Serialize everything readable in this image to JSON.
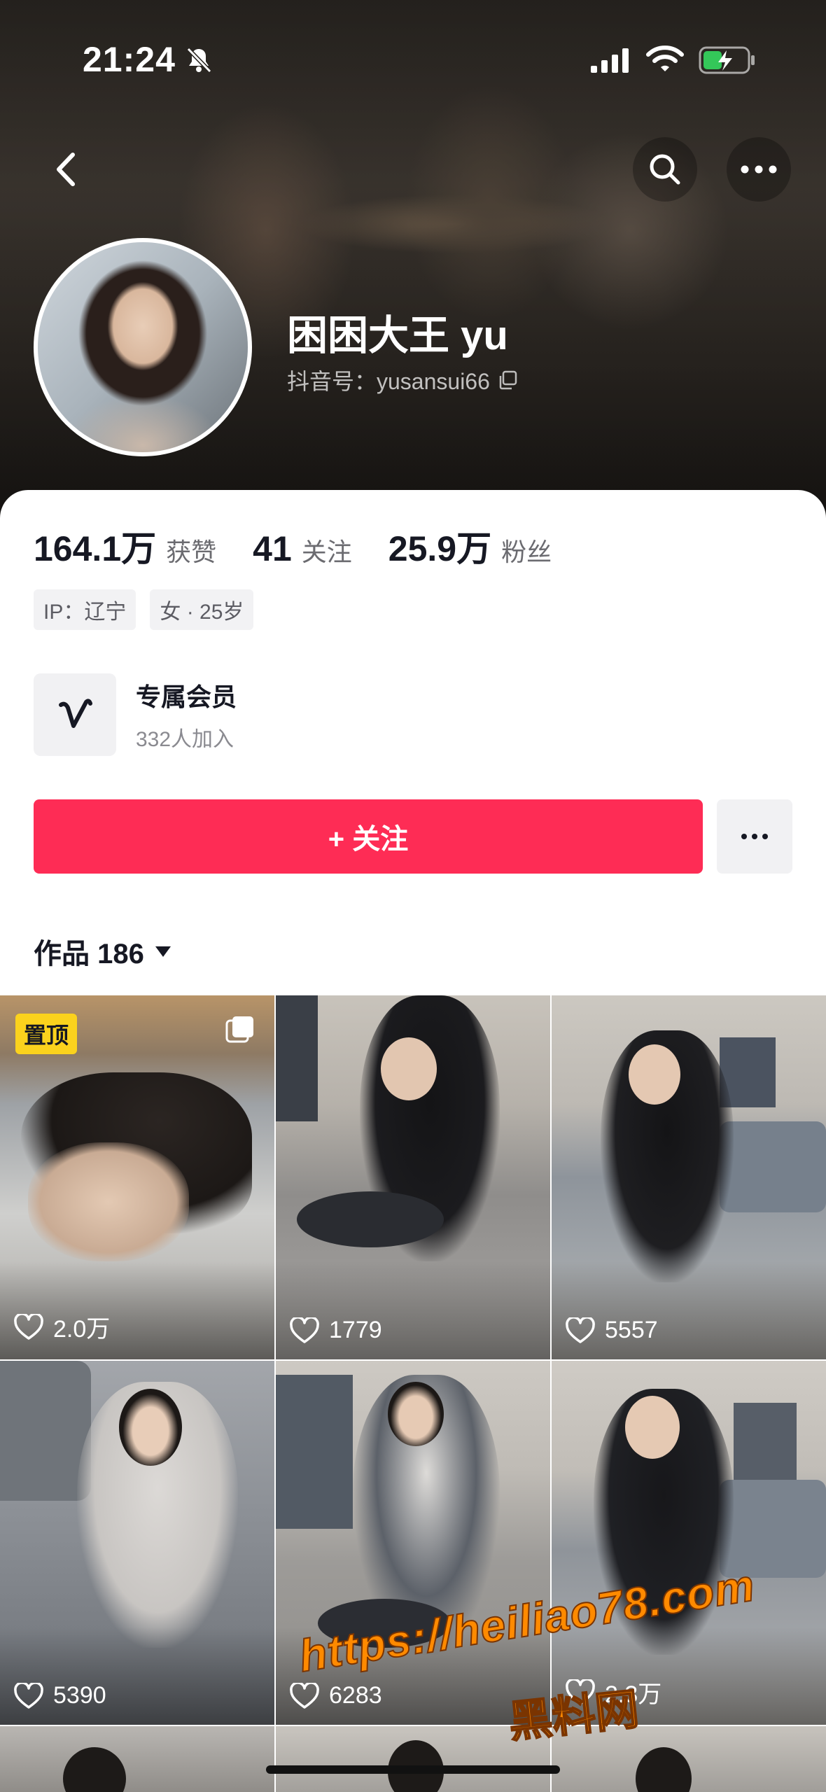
{
  "status_bar": {
    "time": "21:24",
    "icons": [
      "bell-off-icon",
      "signal-icon",
      "wifi-icon",
      "battery-charging-icon"
    ]
  },
  "header": {
    "nav_icons": [
      "back-icon",
      "search-icon",
      "more-icon"
    ]
  },
  "profile": {
    "nickname": "困困大王 yu",
    "douyin_id": "抖音号：yusansui66"
  },
  "stats": [
    {
      "value": "164.1万",
      "label": "获赞"
    },
    {
      "value": "41",
      "label": "关注"
    },
    {
      "value": "25.9万",
      "label": "粉丝"
    }
  ],
  "tags": [
    {
      "text": "IP：辽宁"
    },
    {
      "text": "女 · 25岁"
    }
  ],
  "member": {
    "title": "专属会员",
    "subtitle": "332人加入"
  },
  "follow_button": {
    "label": "+ 关注"
  },
  "works": {
    "label": "作品 186"
  },
  "videos": [
    {
      "likes": "2.0万",
      "pinned": true,
      "pin_label": "置顶",
      "multi": true
    },
    {
      "likes": "1779"
    },
    {
      "likes": "5557"
    },
    {
      "likes": "5390"
    },
    {
      "likes": "6283"
    },
    {
      "likes": "2.3万"
    }
  ],
  "watermark": {
    "url": "https://heiliao78.com",
    "name": "黑料网"
  },
  "colors": {
    "accent": "#fe2c55",
    "pin_badge": "#fbd21d",
    "watermark": "#ff8a00"
  }
}
